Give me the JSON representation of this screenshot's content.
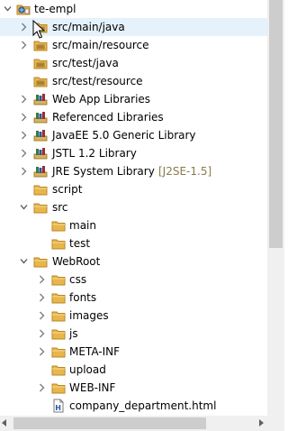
{
  "tree": {
    "rows": [
      {
        "label": "te-empl",
        "icon": "project-icon",
        "arrow": "down",
        "level": 0
      },
      {
        "label": "src/main/java",
        "icon": "source-folder-icon",
        "arrow": "right",
        "level": 1,
        "selected": true
      },
      {
        "label": "src/main/resource",
        "icon": "source-folder-icon",
        "arrow": "right",
        "level": 1
      },
      {
        "label": "src/test/java",
        "icon": "source-folder-icon",
        "arrow": "none",
        "level": 1
      },
      {
        "label": "src/test/resource",
        "icon": "source-folder-icon",
        "arrow": "none",
        "level": 1
      },
      {
        "label": "Web App Libraries",
        "icon": "library-icon",
        "arrow": "right",
        "level": 1
      },
      {
        "label": "Referenced Libraries",
        "icon": "library-icon",
        "arrow": "right",
        "level": 1
      },
      {
        "label": "JavaEE 5.0 Generic Library",
        "icon": "library-icon",
        "arrow": "right",
        "level": 1
      },
      {
        "label": "JSTL 1.2 Library",
        "icon": "library-icon",
        "arrow": "right",
        "level": 1
      },
      {
        "label": "JRE System Library",
        "icon": "library-icon",
        "arrow": "right",
        "level": 1,
        "decoration": "[J2SE-1.5]"
      },
      {
        "label": "script",
        "icon": "folder-icon",
        "arrow": "none",
        "level": 1
      },
      {
        "label": "src",
        "icon": "folder-icon",
        "arrow": "down",
        "level": 1
      },
      {
        "label": "main",
        "icon": "folder-icon",
        "arrow": "none",
        "level": 2
      },
      {
        "label": "test",
        "icon": "folder-icon",
        "arrow": "none",
        "level": 2
      },
      {
        "label": "WebRoot",
        "icon": "folder-icon",
        "arrow": "down",
        "level": 1
      },
      {
        "label": "css",
        "icon": "folder-icon",
        "arrow": "right",
        "level": 2
      },
      {
        "label": "fonts",
        "icon": "folder-icon",
        "arrow": "right",
        "level": 2
      },
      {
        "label": "images",
        "icon": "folder-icon",
        "arrow": "right",
        "level": 2
      },
      {
        "label": "js",
        "icon": "folder-icon",
        "arrow": "right",
        "level": 2
      },
      {
        "label": "META-INF",
        "icon": "folder-icon",
        "arrow": "right",
        "level": 2
      },
      {
        "label": "upload",
        "icon": "folder-icon",
        "arrow": "none",
        "level": 2
      },
      {
        "label": "WEB-INF",
        "icon": "folder-icon",
        "arrow": "right",
        "level": 2
      },
      {
        "label": "company_department.html",
        "icon": "html-file-icon",
        "arrow": "none",
        "level": 2
      }
    ]
  },
  "colors": {
    "folder": "#e8b64a",
    "folder_dark": "#b8862a",
    "library_book": "#2f7d4a",
    "decoration": "#8a7a4a",
    "selection": "#e5f1fb",
    "scrollbar_track": "#f0f0f0",
    "scrollbar_thumb": "#cdcdcd"
  }
}
